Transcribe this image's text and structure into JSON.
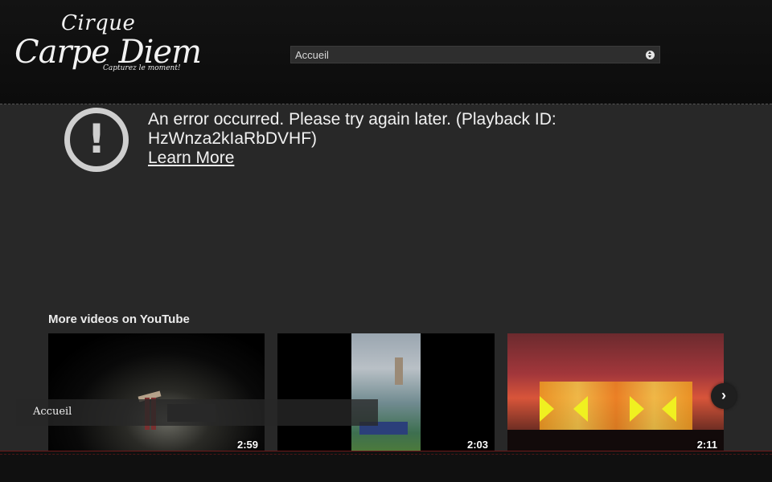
{
  "header": {
    "logo_line1": "Cirque",
    "logo_line2": "Carpe Diem",
    "logo_tagline": "Capturez le moment!",
    "nav_select_value": "Accueil"
  },
  "player": {
    "error_message": "An error occurred. Please try again later. (Playback ID: HzWnza2kIaRbDVHF)",
    "learn_more": "Learn More",
    "error_icon": "!"
  },
  "more_videos": {
    "title": "More videos on YouTube",
    "videos": [
      {
        "duration": "2:59"
      },
      {
        "duration": "2:03"
      },
      {
        "duration": "2:11"
      }
    ],
    "next_icon": "chevron-right-icon",
    "next_glyph": "›"
  },
  "overlay": {
    "label": "Accueil"
  },
  "colors": {
    "background": "#282828",
    "header": "#0c0c0c",
    "footer_accent": "#6e1a1a"
  }
}
